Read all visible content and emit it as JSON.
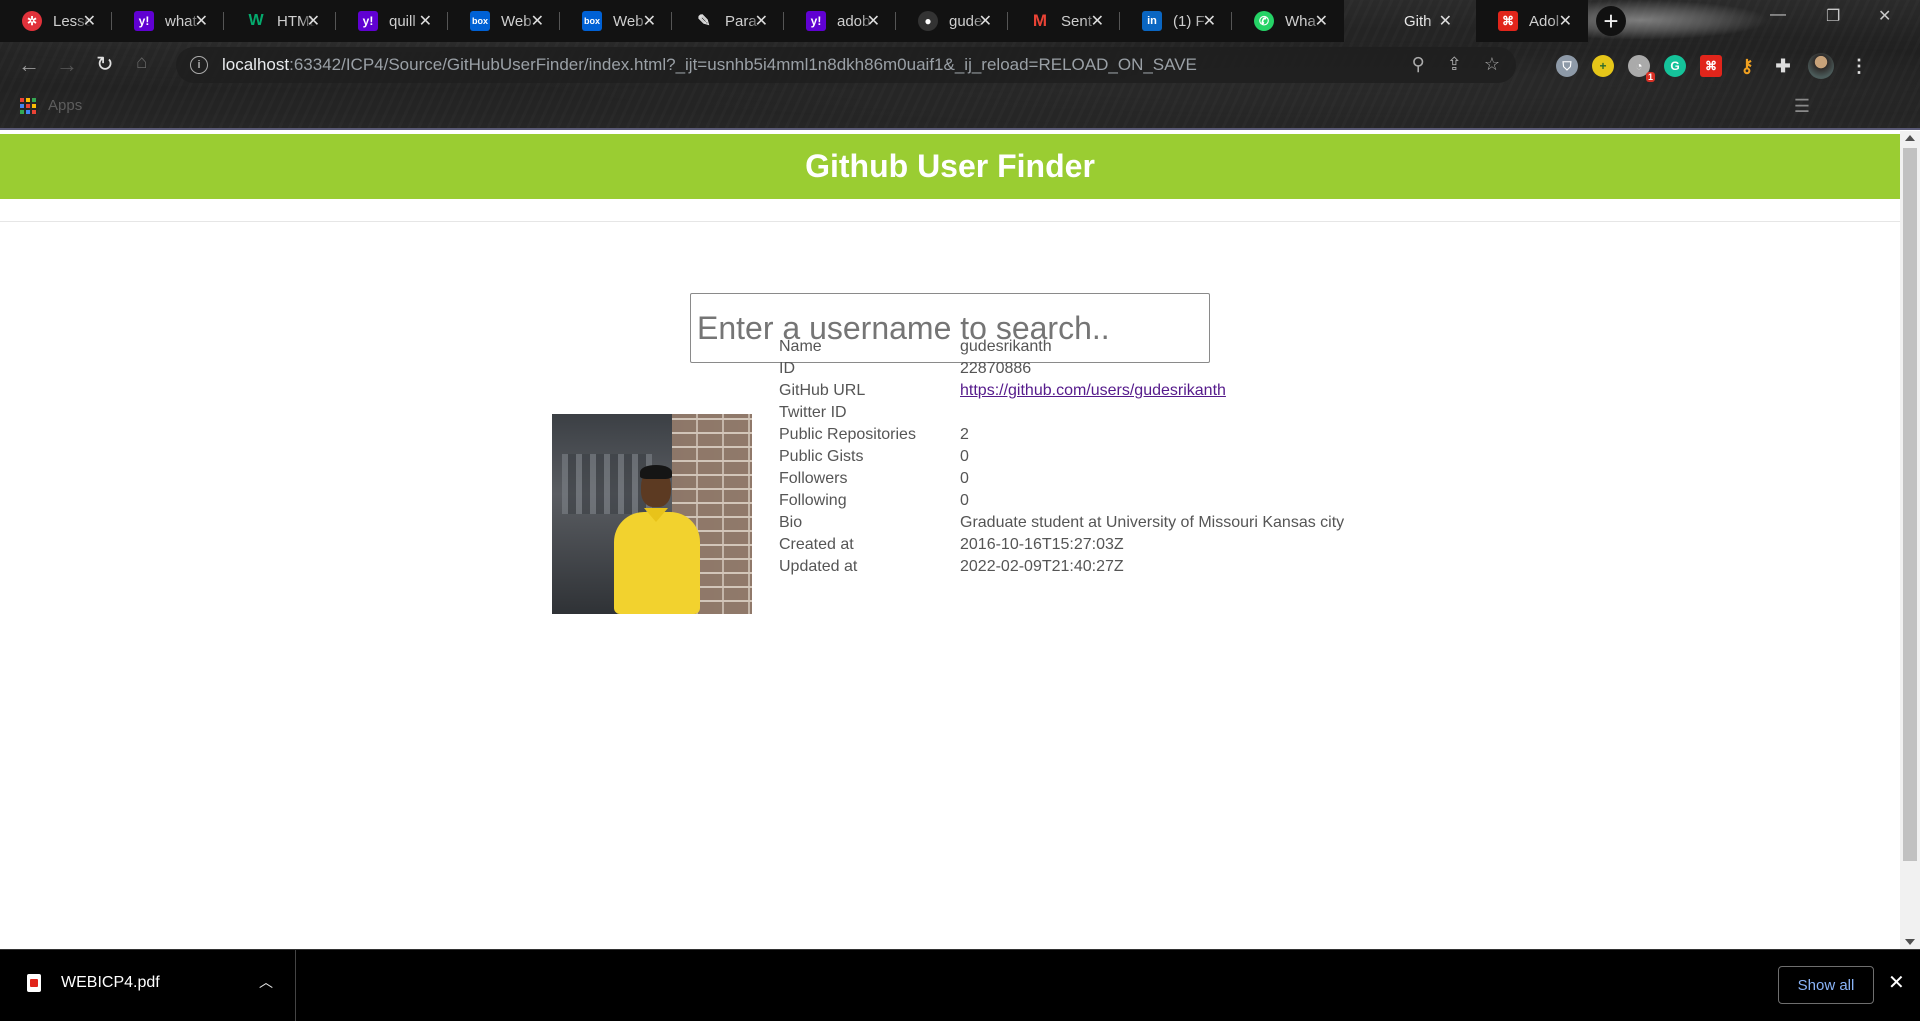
{
  "browser": {
    "tabs": [
      {
        "label": "Lesson",
        "icon": "canvas-icon",
        "color": "#e2323b"
      },
      {
        "label": "what",
        "icon": "yahoo-icon",
        "color": "#6001d2"
      },
      {
        "label": "HTML",
        "icon": "w3-icon",
        "color": "#04aa6d"
      },
      {
        "label": "quill",
        "icon": "yahoo-icon",
        "color": "#6001d2"
      },
      {
        "label": "Web",
        "icon": "box-icon",
        "color": "#0061d5"
      },
      {
        "label": "Web",
        "icon": "box-icon",
        "color": "#0061d5"
      },
      {
        "label": "Para",
        "icon": "quill-icon",
        "color": "#cccccc"
      },
      {
        "label": "adob",
        "icon": "yahoo-icon",
        "color": "#6001d2"
      },
      {
        "label": "gude",
        "icon": "github-icon",
        "color": "#333333"
      },
      {
        "label": "Sent",
        "icon": "gmail-icon",
        "color": "#ea4335"
      },
      {
        "label": "(1) F",
        "icon": "linkedin-icon",
        "color": "#0a66c2"
      },
      {
        "label": "Wha",
        "icon": "whatsapp-icon",
        "color": "#25d366"
      },
      {
        "label": "Gith",
        "icon": "none",
        "color": "#000000"
      },
      {
        "label": "Adol",
        "icon": "acrobat-icon",
        "color": "#e1251b"
      }
    ],
    "url_host": "localhost",
    "url_rest": ":63342/ICP4/Source/GitHubUserFinder/index.html?_ijt=usnhb5i4mml1n8dkh86m0uaif1&_ij_reload=RELOAD_ON_SAVE",
    "bookmarks_label": "Apps",
    "extension_badge": "1"
  },
  "page": {
    "title": "Github User Finder",
    "search_placeholder": "Enter a username to search..",
    "accent_color": "#9acd32",
    "profile": {
      "name_label": "Name",
      "name": "gudesrikanth",
      "id_label": "ID",
      "id": "22870886",
      "url_label": "GitHub URL",
      "url": "https://github.com/users/gudesrikanth",
      "twitter_label": "Twitter ID",
      "twitter": "",
      "repos_label": "Public Repositories",
      "repos": "2",
      "gists_label": "Public Gists",
      "gists": "0",
      "followers_label": "Followers",
      "followers": "0",
      "following_label": "Following",
      "following": "0",
      "bio_label": "Bio",
      "bio": "Graduate student at University of Missouri Kansas city",
      "created_label": "Created at",
      "created": "2016-10-16T15:27:03Z",
      "updated_label": "Updated at",
      "updated": "2022-02-09T21:40:27Z"
    }
  },
  "downloads": {
    "file_name": "WEBICP4.pdf",
    "show_all_label": "Show all"
  }
}
